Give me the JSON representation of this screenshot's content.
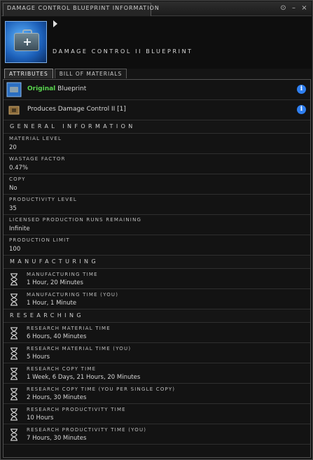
{
  "window": {
    "title": "DAMAGE CONTROL BLUEPRINT INFORMATION",
    "buttons": [
      "⊙",
      "–",
      "×"
    ]
  },
  "header": {
    "item_name": "DAMAGE CONTROL II BLUEPRINT"
  },
  "tabs": [
    {
      "label": "ATTRIBUTES",
      "active": true
    },
    {
      "label": "BILL OF MATERIALS",
      "active": false
    }
  ],
  "summary": {
    "original_label": "Original",
    "blueprint_label": "Blueprint",
    "produces_text": "Produces Damage Control II [1]",
    "info_glyph": "i"
  },
  "general": {
    "heading": "GENERAL INFORMATION",
    "attributes": [
      {
        "label": "MATERIAL LEVEL",
        "value": "20"
      },
      {
        "label": "WASTAGE FACTOR",
        "value": "0.47%"
      },
      {
        "label": "COPY",
        "value": "No"
      },
      {
        "label": "PRODUCTIVITY LEVEL",
        "value": "35"
      },
      {
        "label": "LICENSED PRODUCTION RUNS REMAINING",
        "value": "Infinite"
      },
      {
        "label": "PRODUCTION LIMIT",
        "value": "100"
      }
    ]
  },
  "manufacturing": {
    "heading": "MANUFACTURING",
    "rows": [
      {
        "label": "MANUFACTURING TIME",
        "value": "1 Hour, 20 Minutes"
      },
      {
        "label": "MANUFACTURING TIME (YOU)",
        "value": "1 Hour, 1 Minute"
      }
    ]
  },
  "researching": {
    "heading": "RESEARCHING",
    "rows": [
      {
        "label": "RESEARCH MATERIAL TIME",
        "value": "6 Hours, 40 Minutes"
      },
      {
        "label": "RESEARCH MATERIAL TIME (YOU)",
        "value": "5 Hours"
      },
      {
        "label": "RESEARCH COPY TIME",
        "value": "1 Week, 6 Days, 21 Hours, 20 Minutes"
      },
      {
        "label": "RESEARCH COPY TIME (YOU PER SINGLE COPY)",
        "value": "2 Hours, 30 Minutes"
      },
      {
        "label": "RESEARCH PRODUCTIVITY TIME",
        "value": "10 Hours"
      },
      {
        "label": "RESEARCH PRODUCTIVITY TIME (YOU)",
        "value": "7 Hours, 30 Minutes"
      }
    ]
  },
  "icons": {
    "blueprint": "blueprint-icon",
    "produces": "crate-icon",
    "info": "info-icon",
    "time": "hourglass-icon"
  },
  "colors": {
    "accent_green": "#58d64e",
    "info_blue": "#2f7ff0"
  }
}
